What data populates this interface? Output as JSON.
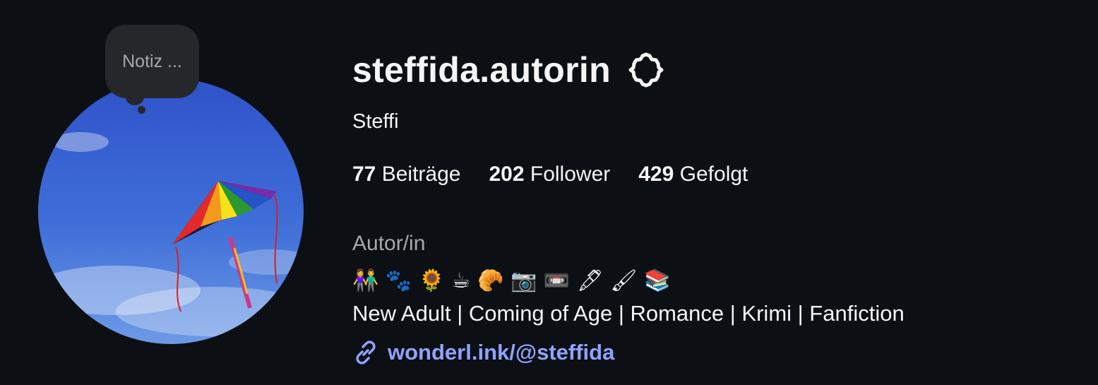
{
  "profile": {
    "username": "steffida.autorin",
    "display_name": "Steffi",
    "note_placeholder": "Notiz ...",
    "stats": {
      "posts_count": "77",
      "posts_label": "Beiträge",
      "followers_count": "202",
      "followers_label": "Follower",
      "following_count": "429",
      "following_label": "Gefolgt"
    },
    "category": "Autor/in",
    "bio_emojis": "👫 🐾 🌻 ☕ 🥐 📷 📼 🖋 🖌 📚",
    "bio_genres": "New Adult | Coming of Age | Romance | Krimi | Fanfiction",
    "link_text": "wonderl.ink/@steffida",
    "icons": {
      "settings": "gear-icon",
      "link": "link-icon",
      "avatar": "kite-in-sky-photo"
    }
  },
  "colors": {
    "background": "#0c0f14",
    "text": "#f5f5f5",
    "muted": "#a8a8a8",
    "link": "#8fa3ff",
    "note_bubble": "#26272b"
  }
}
